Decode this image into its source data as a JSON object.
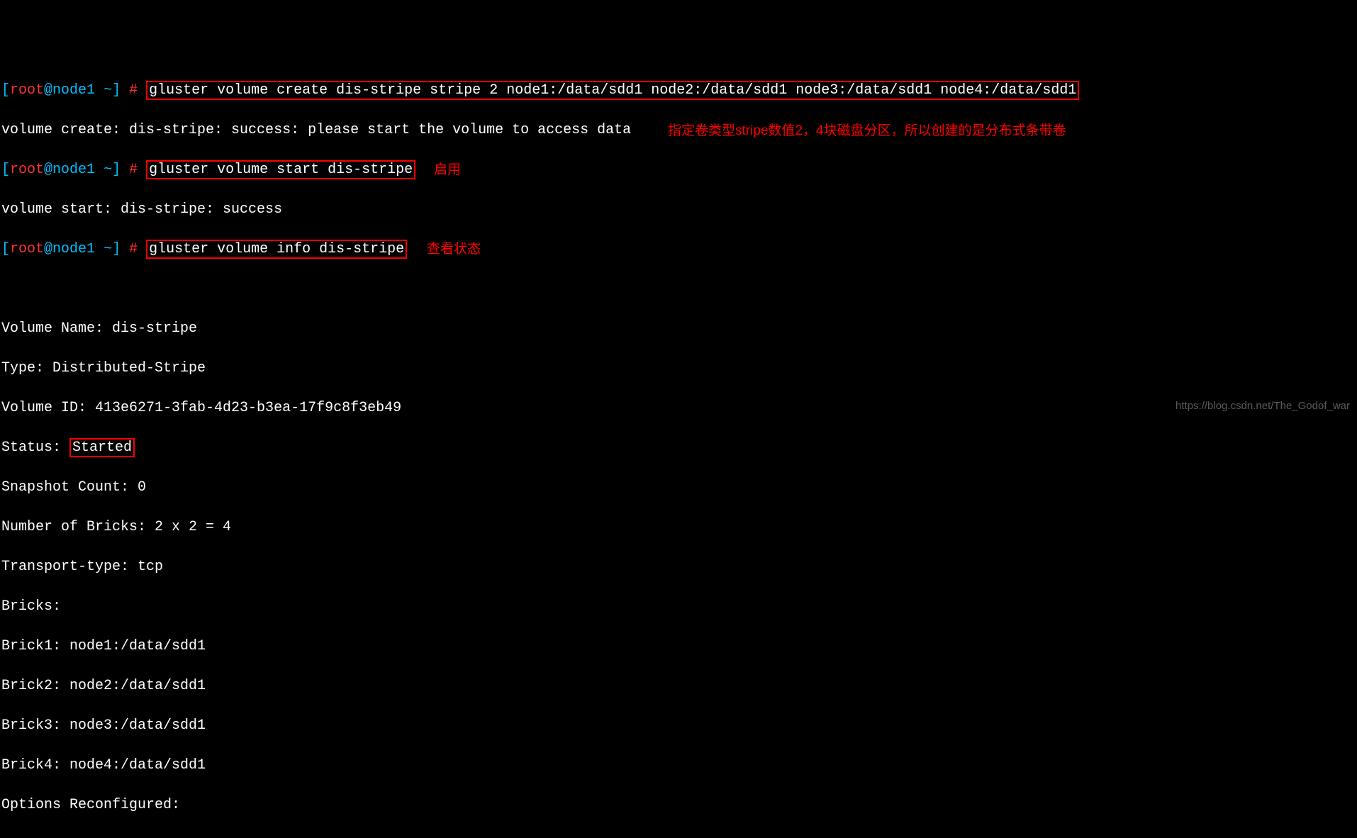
{
  "prompt": {
    "lbracket": "[",
    "user": "root",
    "at": "@",
    "host": "node1",
    "cwd": " ~",
    "rbracket": "]",
    "hash": " # "
  },
  "commands": {
    "create": "gluster volume create dis-stripe stripe 2 node1:/data/sdd1 node2:/data/sdd1 node3:/data/sdd1 node4:/data/sdd1",
    "create_output": "volume create: dis-stripe: success: please start the volume to access data",
    "start": "gluster volume start dis-stripe",
    "start_output": "volume start: dis-stripe: success",
    "info": "gluster volume info dis-stripe"
  },
  "annotations": {
    "create_note": "指定卷类型stripe数值2，4块磁盘分区，所以创建的是分布式条带卷",
    "start_note": "启用",
    "info_note": "查看状态"
  },
  "info_output": {
    "blank1": " ",
    "volume_name": "Volume Name: dis-stripe",
    "type": "Type: Distributed-Stripe",
    "volume_id": "Volume ID: 413e6271-3fab-4d23-b3ea-17f9c8f3eb49",
    "status_label": "Status: ",
    "status_value": "Started",
    "snapshot_count": "Snapshot Count: 0",
    "number_of_bricks": "Number of Bricks: 2 x 2 = 4",
    "transport_type": "Transport-type: tcp",
    "bricks_header": "Bricks:",
    "brick1": "Brick1: node1:/data/sdd1",
    "brick2": "Brick2: node2:/data/sdd1",
    "brick3": "Brick3: node3:/data/sdd1",
    "brick4": "Brick4: node4:/data/sdd1",
    "options": "Options Reconfigured:"
  },
  "watermark": "https://blog.csdn.net/The_Godof_war"
}
